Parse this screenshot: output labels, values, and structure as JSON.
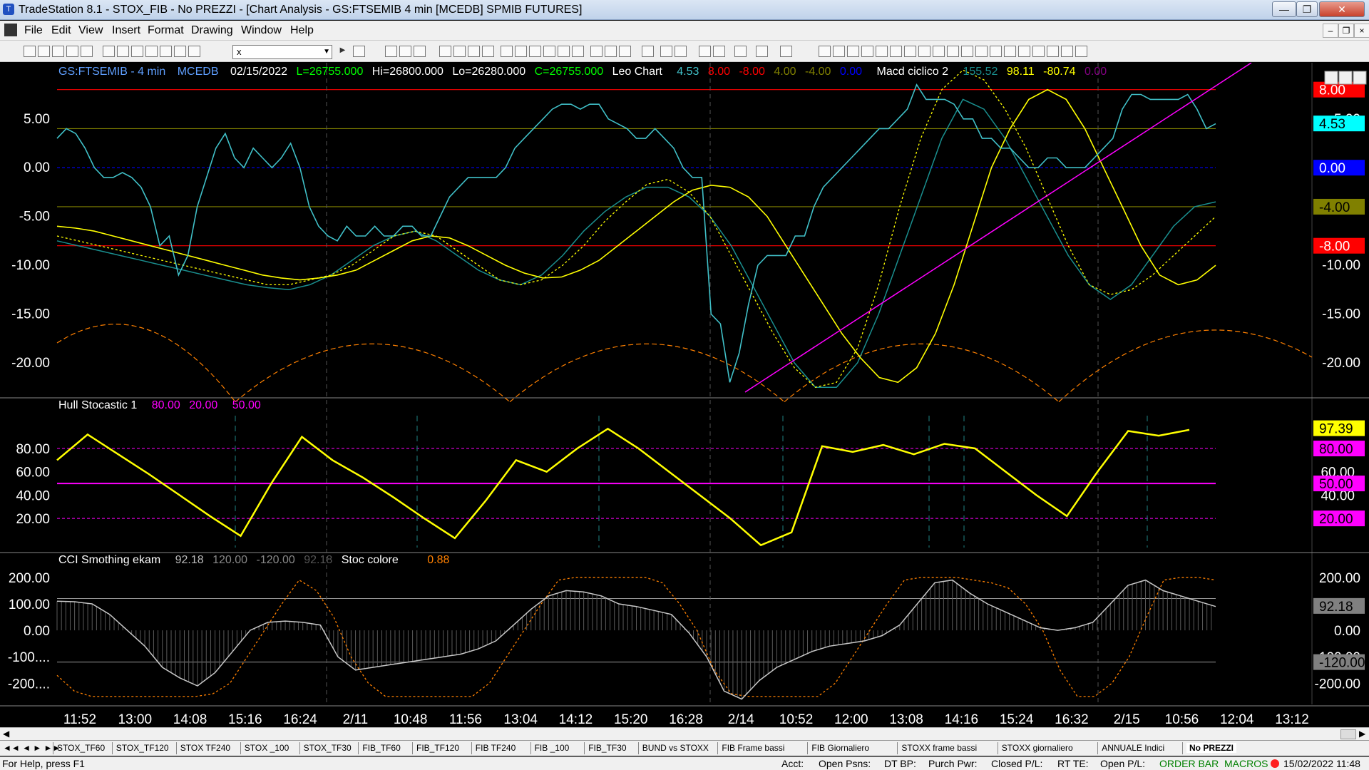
{
  "window": {
    "title": "TradeStation 8.1 - STOX_FIB - No PREZZI - [Chart Analysis - GS:FTSEMIB  4 min  [MCEDB] SPMIB FUTURES]"
  },
  "menu": [
    "File",
    "Edit",
    "View",
    "Insert",
    "Format",
    "Drawing",
    "Window",
    "Help"
  ],
  "toolbar": {
    "symbol_value": "x"
  },
  "header": {
    "symbol": "GS:FTSEMIB - 4 min",
    "feed": "MCEDB",
    "date": "02/15/2022",
    "last": "L=26755.000",
    "high": "Hi=26800.000",
    "low": "Lo=26280.000",
    "close": "C=26755.000",
    "study1": "Leo Chart",
    "s1v1": "4.53",
    "s1v2": "8.00",
    "s1v3": "-8.00",
    "s1v4": "4.00",
    "s1v5": "-4.00",
    "s1v6": "0.00",
    "study2": "Macd ciclico 2",
    "s2v1": "155.52",
    "s2v2": "98.11",
    "s2v3": "-80.74",
    "s2v4": "0.00"
  },
  "pane2_header": {
    "name": "Hull Stocastic 1",
    "v1": "80.00",
    "v2": "20.00",
    "v3": "50.00"
  },
  "pane3_header": {
    "name": "CCI Smothing ekam",
    "v1": "92.18",
    "v2": "120.00",
    "v3": "-120.00",
    "v4": "92.18",
    "name2": "Stoc colore",
    "v5": "0.88"
  },
  "axis1_ticks": [
    "5.00",
    "0.00",
    "-5.00",
    "-10.00",
    "-15.00",
    "-20.00"
  ],
  "axis1_right_ticks": [
    "5.00",
    "-10.00",
    "-15.00",
    "-20.00"
  ],
  "axis2_ticks": [
    "80.00",
    "60.00",
    "40.00",
    "20.00"
  ],
  "axis2_right_ticks": [
    "60.00",
    "40.00"
  ],
  "axis3_ticks": [
    "200.00",
    "100.00",
    "0.00",
    "-100....",
    "-200...."
  ],
  "axis3_right_ticks": [
    "200.00",
    "0.00",
    "-100.00",
    "-200.00"
  ],
  "right_tags": {
    "p1": [
      {
        "text": "8.00",
        "bg": "#ff0000",
        "fg": "#ffffff"
      },
      {
        "text": "4.53",
        "bg": "#00ffff",
        "fg": "#000000"
      },
      {
        "text": "0.00",
        "bg": "#0000ff",
        "fg": "#ffffff"
      },
      {
        "text": "-4.00",
        "bg": "#808000",
        "fg": "#000000"
      },
      {
        "text": "-8.00",
        "bg": "#ff0000",
        "fg": "#ffffff"
      }
    ],
    "p2": [
      {
        "text": "97.39",
        "bg": "#ffff00",
        "fg": "#000000"
      },
      {
        "text": "80.00",
        "bg": "#ff00ff",
        "fg": "#000000"
      },
      {
        "text": "50.00",
        "bg": "#ff00ff",
        "fg": "#000000"
      },
      {
        "text": "20.00",
        "bg": "#ff00ff",
        "fg": "#000000"
      }
    ],
    "p3": [
      {
        "text": "92.18",
        "bg": "#808080",
        "fg": "#000000"
      },
      {
        "text": "-120.00",
        "bg": "#808080",
        "fg": "#000000"
      }
    ]
  },
  "time_axis": [
    "11:52",
    "13:00",
    "14:08",
    "15:16",
    "16:24",
    "2/11",
    "10:48",
    "11:56",
    "13:04",
    "14:12",
    "15:20",
    "16:28",
    "2/14",
    "10:52",
    "12:00",
    "13:08",
    "14:16",
    "15:24",
    "16:32",
    "2/15",
    "10:56",
    "12:04",
    "13:12"
  ],
  "tabs": [
    "STOX_TF60",
    "STOX_TF120",
    "STOX TF240",
    "STOX _100",
    "STOX_TF30",
    "FIB_TF60",
    "FIB_TF120",
    "FIB TF240",
    "FIB _100",
    "FIB_TF30",
    "BUND vs STOXX",
    "FIB Frame bassi",
    "FIB Giornaliero",
    "STOXX frame bassi",
    "STOXX giornaliero",
    "ANNUALE Indici",
    "No PREZZI"
  ],
  "status": {
    "help": "For Help, press F1",
    "acct": "Acct:",
    "open_psns": "Open Psns:",
    "dt_bp": "DT BP:",
    "purch_pwr": "Purch Pwr:",
    "closed_pl": "Closed P/L:",
    "rt_te": "RT TE:",
    "open_pl": "Open P/L:",
    "mode": "ORDER BAR",
    "macros": "MACROS",
    "datetime": "15/02/2022 11:48"
  },
  "chart_data": {
    "type": "line",
    "colors": {
      "price": "#40c0c8",
      "yellow": "#ffff00",
      "red": "#ff0000",
      "olive": "#808000",
      "magenta": "#ff00ff",
      "orange": "#ff8000",
      "teal": "#1a8f8f"
    },
    "pane1": {
      "ylim": [
        -23,
        9
      ],
      "levels": [
        8,
        4,
        0,
        -4,
        -8
      ],
      "price": [
        3,
        4,
        3.5,
        2,
        0,
        -1,
        -1,
        -0.5,
        -1,
        -2,
        -4,
        -8,
        -7,
        -11,
        -9,
        -4,
        -1,
        2,
        3.5,
        1,
        0,
        2,
        1,
        0,
        1,
        2.5,
        0,
        -4,
        -6,
        -7,
        -7.5,
        -6,
        -7,
        -7,
        -6,
        -7,
        -7,
        -6,
        -6,
        -7,
        -7,
        -5,
        -3,
        -2,
        -1,
        -1,
        -1,
        -1,
        0,
        2,
        3,
        4,
        5,
        6,
        6.5,
        6.5,
        6,
        6.5,
        6.5,
        5,
        4.5,
        4,
        3,
        3,
        4,
        3,
        2,
        0,
        -1,
        -1,
        -15,
        -16,
        -22,
        -19,
        -14,
        -10,
        -9,
        -9,
        -9,
        -7,
        -7,
        -4,
        -2,
        -1,
        0,
        1,
        2,
        3,
        4,
        4,
        5,
        6,
        8.5,
        7,
        7,
        7,
        6.5,
        5,
        5,
        3,
        3,
        2,
        2,
        1,
        0,
        0,
        1,
        1,
        0,
        0,
        0,
        1,
        2,
        3,
        6,
        7.5,
        7.5,
        7,
        7,
        7,
        7,
        7.5,
        6,
        4,
        4.5
      ],
      "yellow_solid": [
        -6,
        -6.2,
        -6.5,
        -7,
        -7.5,
        -8,
        -8.5,
        -9,
        -9.5,
        -10,
        -10.5,
        -11,
        -11.3,
        -11.5,
        -11.3,
        -11,
        -10.5,
        -9.5,
        -8.5,
        -7.5,
        -7,
        -7.2,
        -8,
        -9,
        -10,
        -10.8,
        -11.3,
        -11.2,
        -10.5,
        -9.5,
        -8,
        -6.5,
        -5,
        -3.5,
        -2.3,
        -1.8,
        -2,
        -3,
        -5,
        -8,
        -11,
        -14,
        -17,
        -19.5,
        -21.5,
        -22,
        -20.5,
        -17,
        -12,
        -6,
        0,
        4,
        7,
        8,
        7,
        4,
        0,
        -4,
        -8,
        -11,
        -12,
        -11.5,
        -10
      ],
      "yellow_dotted": [
        -7,
        -7.5,
        -8,
        -8.5,
        -9,
        -9.5,
        -10,
        -10.5,
        -11,
        -11.5,
        -12,
        -12,
        -11.5,
        -11,
        -10,
        -8.5,
        -7,
        -6.5,
        -7,
        -8.5,
        -10,
        -11.5,
        -12,
        -11.5,
        -10,
        -8,
        -5.5,
        -3.5,
        -1.7,
        -1.2,
        -2.5,
        -5,
        -9,
        -13,
        -17,
        -20.5,
        -22.5,
        -22,
        -18.5,
        -12,
        -4,
        3,
        8,
        10,
        9,
        6,
        2,
        -3,
        -8,
        -12,
        -13,
        -12.5,
        -11,
        -9,
        -7,
        -5
      ],
      "teal_line": [
        -7.5,
        -8,
        -8.5,
        -9,
        -9.5,
        -10,
        -10.5,
        -11,
        -11.5,
        -12,
        -12.3,
        -12.5,
        -12,
        -11,
        -9.5,
        -8,
        -7,
        -6.5,
        -7.5,
        -9,
        -10.5,
        -11.5,
        -12,
        -11,
        -9,
        -6.5,
        -4.5,
        -3,
        -2,
        -2,
        -3,
        -5,
        -8,
        -12,
        -16,
        -20,
        -22.5,
        -22.5,
        -20,
        -15,
        -9,
        -3,
        3,
        7,
        6,
        3,
        -1,
        -5,
        -9,
        -12,
        -13.5,
        -12,
        -9,
        -6,
        -4,
        -3.5
      ],
      "orange_arcs": [
        [
          0,
          -20
        ],
        [
          0.135,
          -20
        ],
        [
          0.31,
          -22
        ],
        [
          0.6,
          -22
        ],
        [
          0.72,
          -20
        ]
      ],
      "trend_start": [
        0.47,
        -23
      ],
      "trend_end": [
        0.98,
        9
      ]
    },
    "pane2": {
      "ylim": [
        -5,
        110
      ],
      "levels": [
        80,
        50,
        20
      ],
      "series": [
        70,
        92,
        75,
        58,
        40,
        22,
        5,
        50,
        90,
        70,
        55,
        38,
        20,
        3,
        35,
        70,
        60,
        80,
        97,
        80,
        60,
        40,
        20,
        -3,
        8,
        82,
        77,
        83,
        75,
        84,
        80,
        60,
        40,
        22,
        60,
        95,
        91,
        96
      ]
    },
    "pane3": {
      "ylim": [
        -280,
        240
      ],
      "levels": [
        120,
        -120
      ],
      "cci": [
        110,
        108,
        100,
        60,
        0,
        -60,
        -140,
        -180,
        -210,
        -160,
        -80,
        0,
        30,
        35,
        30,
        20,
        -100,
        -150,
        -140,
        -130,
        -120,
        -110,
        -100,
        -90,
        -70,
        -40,
        20,
        80,
        130,
        150,
        145,
        130,
        100,
        90,
        75,
        60,
        -10,
        -100,
        -230,
        -260,
        -190,
        -140,
        -110,
        -80,
        -60,
        -50,
        -40,
        -20,
        20,
        100,
        180,
        190,
        140,
        100,
        70,
        40,
        10,
        0,
        10,
        30,
        100,
        170,
        190,
        150,
        130,
        110,
        90
      ],
      "stoc_orange": [
        -170,
        -230,
        -250,
        -250,
        -250,
        -250,
        -250,
        -250,
        -250,
        -240,
        -200,
        -100,
        0,
        100,
        190,
        150,
        50,
        -100,
        -200,
        -250,
        -250,
        -250,
        -250,
        -250,
        -250,
        -200,
        -100,
        0,
        100,
        190,
        200,
        200,
        200,
        200,
        200,
        180,
        100,
        0,
        -150,
        -240,
        -250,
        -250,
        -250,
        -250,
        -250,
        -200,
        -100,
        0,
        100,
        190,
        200,
        200,
        200,
        190,
        180,
        160,
        100,
        0,
        -150,
        -250,
        -250,
        -200,
        -100,
        50,
        190,
        200,
        200,
        190
      ]
    }
  }
}
